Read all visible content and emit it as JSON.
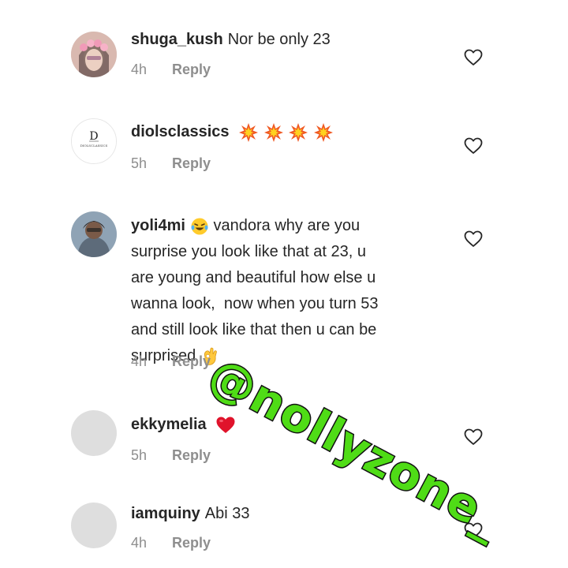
{
  "comments": [
    {
      "username": "shuga_kush",
      "text": "Nor be only 23",
      "time": "4h",
      "reply": "Reply",
      "avatar": "profile-photo-with-flower-crown",
      "liked": false
    },
    {
      "username": "diolsclassics",
      "text": "",
      "emojis": [
        "collision",
        "collision",
        "collision",
        "collision"
      ],
      "time": "5h",
      "reply": "Reply",
      "avatar": "diolsclassics-logo",
      "avatar_logo_text": "DIOLSCLASSICS",
      "liked": false
    },
    {
      "username": "yoli4mi",
      "text_lines": [
        "vandora why are you",
        "surprise you look like that at 23, u",
        "are young and beautiful how else u",
        "wanna look,  now when you turn 53",
        "and still look like that then u can be",
        "surprised"
      ],
      "emojis": [
        "laughing-tears",
        "ok-hand"
      ],
      "time": "4h",
      "reply": "Reply",
      "avatar": "profile-photo",
      "liked": false
    },
    {
      "username": "ekkymelia",
      "text": "",
      "emojis": [
        "red-heart"
      ],
      "time": "5h",
      "reply": "Reply",
      "avatar": "default-avatar",
      "liked": false
    },
    {
      "username": "iamquiny",
      "text": "Abi 33",
      "time": "4h",
      "reply": "Reply",
      "avatar": "default-avatar",
      "liked": false
    }
  ],
  "watermark": "@nollyzone_",
  "colors": {
    "text": "#262626",
    "meta": "#8e8e8e",
    "watermark_fill": "#4fdc16",
    "watermark_stroke": "#111111",
    "heart_red": "#e0132b",
    "collision_orange": "#f05a24"
  }
}
